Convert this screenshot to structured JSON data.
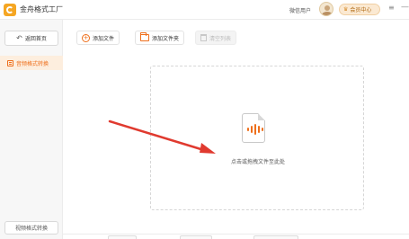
{
  "titlebar": {
    "app_title": "金舟格式工厂",
    "user_name": "微信用户",
    "vip_label": "会员中心",
    "menu_icon": "≡",
    "minimize_icon": "—"
  },
  "sidebar": {
    "back_label": "返回首页",
    "back_icon": "↶",
    "nav_items": [
      {
        "label": "音频格式转换"
      }
    ],
    "bottom_button_label": "视频格式转换"
  },
  "toolbar": {
    "add_file_label": "添加文件",
    "add_folder_label": "添加文件夹",
    "clear_label": "清空列表"
  },
  "dropzone": {
    "hint": "点击或拖拽文件至此处"
  },
  "colors": {
    "accent": "#ee6f1b",
    "vip_bg": "#fbe9d2",
    "arrow": "#e03a2f"
  }
}
